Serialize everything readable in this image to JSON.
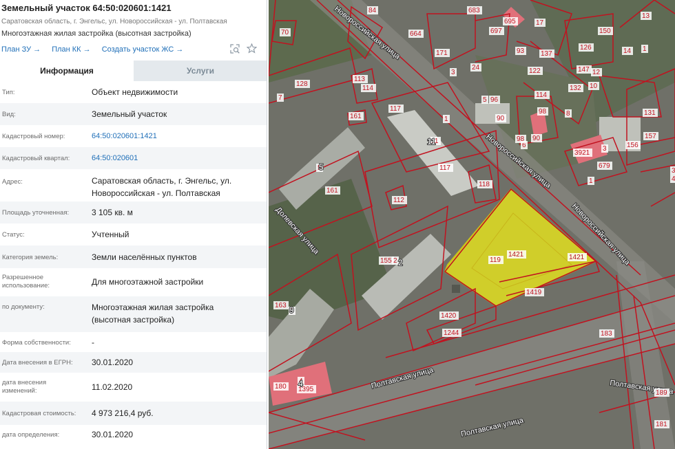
{
  "parcel": {
    "title": "Земельный участок 64:50:020601:1421",
    "address_short": "Саратовская область, г. Энгельс, ул. Новороссийская - ул. Полтавская",
    "use_short": "Многоэтажная жилая застройка (высотная застройка)"
  },
  "actions": {
    "plan_zu": "План ЗУ →",
    "plan_kk": "План КК →",
    "create_zhs": "Создать участок ЖС →",
    "zoom_icon": "zoom-to-icon",
    "favorite_icon": "star-icon"
  },
  "tabs": {
    "info": "Информация",
    "services": "Услуги"
  },
  "rows": [
    {
      "label": "Тип:",
      "value": "Объект недвижимости"
    },
    {
      "label": "Вид:",
      "value": "Земельный участок"
    },
    {
      "label": "Кадастровый номер:",
      "value": "64:50:020601:1421"
    },
    {
      "label": "Кадастровый квартал:",
      "value": "64:50:020601"
    },
    {
      "label": "Адрес:",
      "value_line1": "Саратовская область, г. Энгельс, ул.",
      "value_line2": "Новороссийская - ул. Полтавская"
    },
    {
      "label": "Площадь уточненная:",
      "value": "3 105 кв. м"
    },
    {
      "label": "Статус:",
      "value": "Учтенный"
    },
    {
      "label": "Категория земель:",
      "value": "Земли населённых пунктов"
    },
    {
      "label_line1": "Разрешенное",
      "label_line2": "использование:",
      "value": "Для многоэтажной застройки"
    },
    {
      "label": "по документу:",
      "value_line1": "Многоэтажная жилая застройка",
      "value_line2": "(высотная застройка)"
    },
    {
      "label": "Форма собственности:",
      "value": "-"
    },
    {
      "label": "Дата внесения в ЕГРН:",
      "value": "30.01.2020"
    },
    {
      "label_line1": "дата внесения",
      "label_line2": "изменений:",
      "value": "11.02.2020"
    },
    {
      "label": "Кадастровая стоимость:",
      "value": "4 973 216,4 руб."
    },
    {
      "label": "дата определения:",
      "value": "30.01.2020"
    }
  ],
  "map": {
    "streets": {
      "novoross_top": "Новороссийская улица",
      "novoross_mid": "Новороссийская улица",
      "novoross_right": "Новороссийская улица",
      "poltav_main": "Полтавская улица",
      "poltav_bottom": "Полтавская улица",
      "poltav_right": "Полтавская улица",
      "dolev": "Долевская улица"
    },
    "parcel_labels": [
      "70",
      "84",
      "683",
      "695",
      "17",
      "150",
      "14",
      "664",
      "697",
      "13",
      "171",
      "93",
      "126",
      "12",
      "1",
      "128",
      "7",
      "113",
      "114",
      "3",
      "24",
      "137",
      "147",
      "10",
      "122",
      "114",
      "132",
      "8",
      "1",
      "5",
      "96",
      "131",
      "161",
      "117",
      "90",
      "98",
      "6",
      "90",
      "98",
      "11",
      "156",
      "157",
      "3921",
      "679",
      "3",
      "5",
      "117",
      "118",
      "161",
      "1",
      "112",
      "4",
      "3",
      "155",
      "2",
      "119",
      "1421",
      "1421",
      "163",
      "9",
      "1420",
      "1419",
      "1244",
      "183",
      "180",
      "4",
      "1395",
      "189",
      "181"
    ],
    "building_numbers": [
      "5",
      "11",
      "2",
      "9",
      "4"
    ],
    "highlight_color": "#e8e61a",
    "boundary_color": "#c1121f",
    "highlight_parcel_number": "1421"
  }
}
